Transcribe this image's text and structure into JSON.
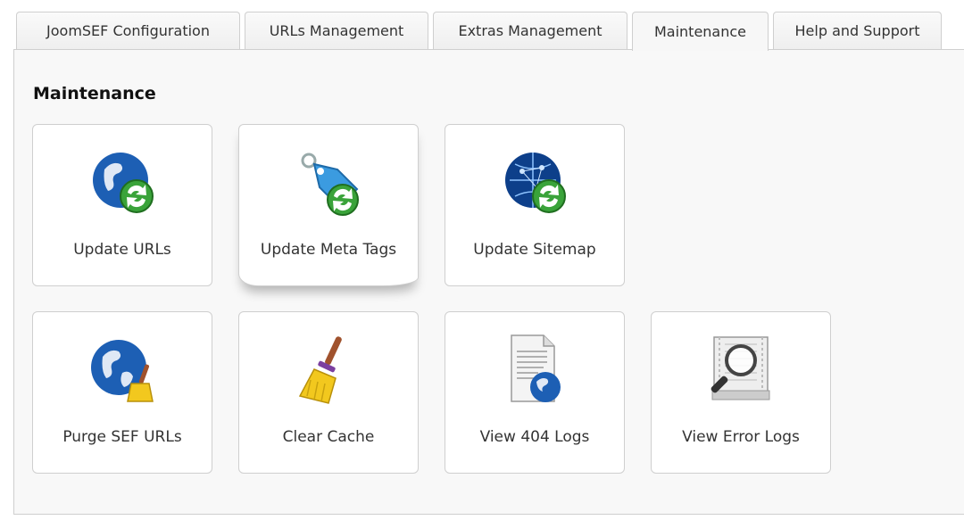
{
  "tabs": [
    {
      "label": "JoomSEF Configuration"
    },
    {
      "label": "URLs Management"
    },
    {
      "label": "Extras Management"
    },
    {
      "label": "Maintenance"
    },
    {
      "label": "Help and Support"
    }
  ],
  "section_title": "Maintenance",
  "tools": [
    {
      "label": "Update URLs",
      "icon": "globe-refresh-icon"
    },
    {
      "label": "Update Meta Tags",
      "icon": "tag-refresh-icon"
    },
    {
      "label": "Update Sitemap",
      "icon": "network-globe-refresh-icon"
    },
    {
      "label": "Purge SEF URLs",
      "icon": "globe-broom-icon"
    },
    {
      "label": "Clear Cache",
      "icon": "broom-icon"
    },
    {
      "label": "View 404 Logs",
      "icon": "document-globe-icon"
    },
    {
      "label": "View Error Logs",
      "icon": "magnifier-log-icon"
    }
  ]
}
